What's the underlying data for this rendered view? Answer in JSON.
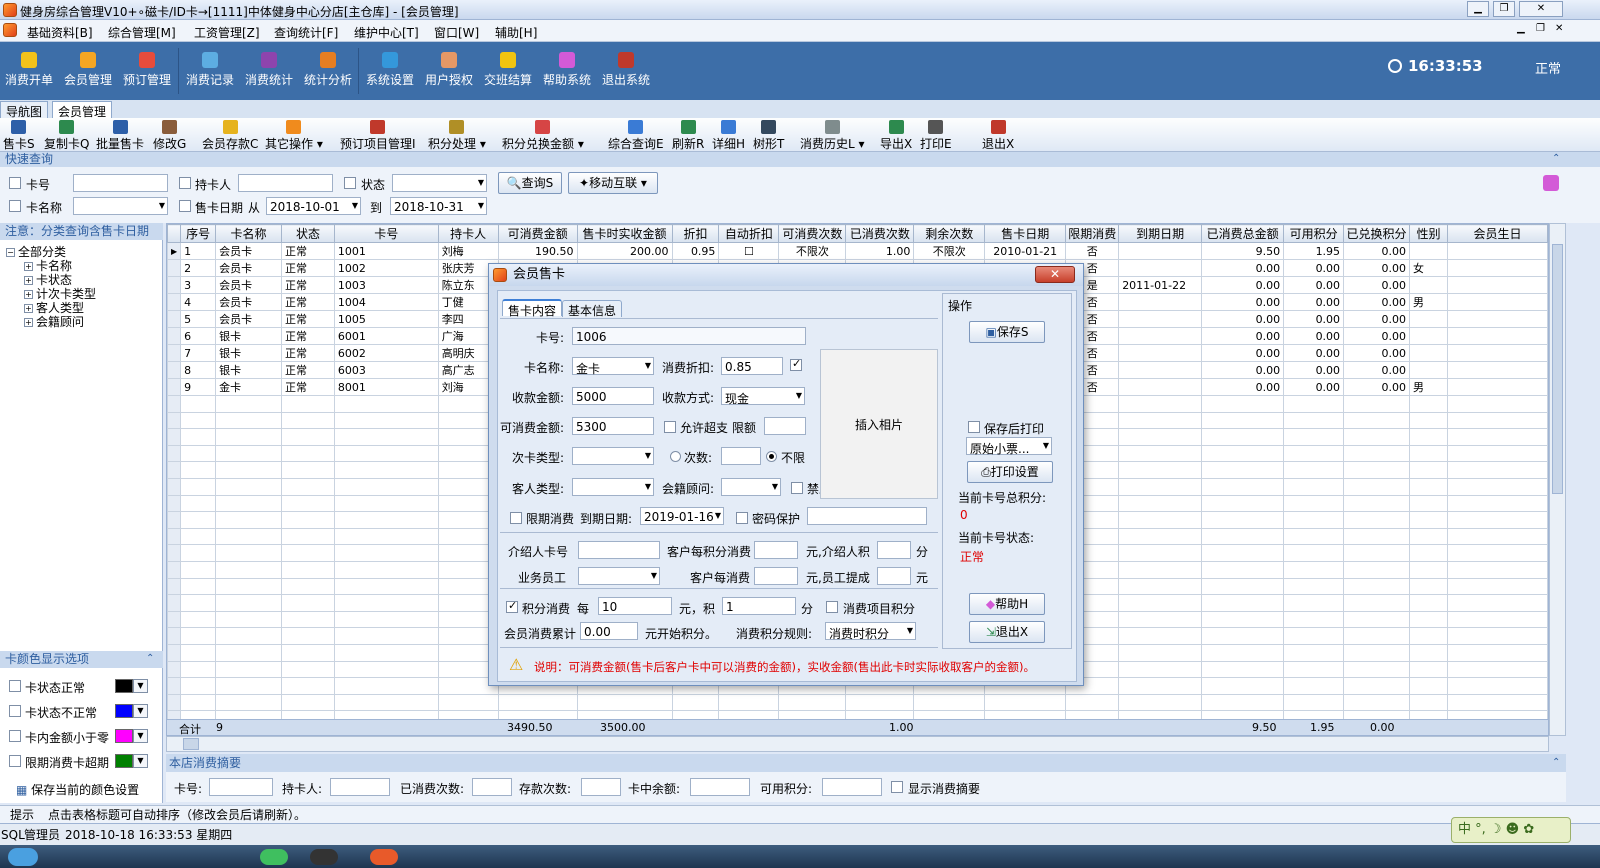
{
  "window": {
    "title": "健身房综合管理V10+∘磁卡/ID卡→[1111]中体健身中心分店[主仓库] - [会员管理]"
  },
  "menu": [
    "基础资料[B]",
    "综合管理[M]",
    "工资管理[Z]",
    "查询统计[F]",
    "维护中心[T]",
    "窗口[W]",
    "辅助[H]"
  ],
  "main_toolbar": [
    {
      "label": "消费开单",
      "icon": "coin-icon",
      "color": "#f2c21b"
    },
    {
      "label": "会员管理",
      "icon": "members-icon",
      "color": "#f5a623"
    },
    {
      "label": "预订管理",
      "icon": "booking-icon",
      "color": "#e74c3c"
    },
    {
      "label": "消费记录",
      "icon": "record-icon",
      "color": "#5dade2"
    },
    {
      "label": "消费统计",
      "icon": "stats-icon",
      "color": "#8e44ad"
    },
    {
      "label": "统计分析",
      "icon": "analysis-icon",
      "color": "#e67e22"
    },
    {
      "label": "系统设置",
      "icon": "settings-icon",
      "color": "#3498db"
    },
    {
      "label": "用户授权",
      "icon": "user-icon",
      "color": "#e59866"
    },
    {
      "label": "交班结算",
      "icon": "handover-icon",
      "color": "#f1c40f"
    },
    {
      "label": "帮助系统",
      "icon": "help-icon",
      "color": "#d35ad7"
    },
    {
      "label": "退出系统",
      "icon": "exit-icon",
      "color": "#c0392b"
    }
  ],
  "clock": "16:33:53",
  "status_mode": "正常",
  "tabs": [
    "导航图",
    "会员管理"
  ],
  "toolbar": [
    {
      "label": "售卡S",
      "icon": "card-icon"
    },
    {
      "label": "复制卡Q",
      "icon": "copy-card-icon"
    },
    {
      "label": "批量售卡",
      "icon": "batch-card-icon"
    },
    {
      "label": "修改G",
      "icon": "edit-icon"
    },
    {
      "label": "会员存款C",
      "icon": "deposit-icon"
    },
    {
      "label": "其它操作",
      "icon": "other-icon"
    },
    {
      "label": "预订项目管理I",
      "icon": "project-icon"
    },
    {
      "label": "积分处理",
      "icon": "points-icon"
    },
    {
      "label": "积分兑换金额",
      "icon": "exchange-icon"
    },
    {
      "label": "综合查询E",
      "icon": "query-icon"
    },
    {
      "label": "刷新R",
      "icon": "refresh-icon"
    },
    {
      "label": "详细H",
      "icon": "detail-icon"
    },
    {
      "label": "树形T",
      "icon": "tree-icon"
    },
    {
      "label": "消费历史L",
      "icon": "history-icon"
    },
    {
      "label": "导出X",
      "icon": "export-icon"
    },
    {
      "label": "打印E",
      "icon": "print-icon"
    },
    {
      "label": "退出X",
      "icon": "exit-icon"
    }
  ],
  "quick": {
    "header": "快速查询",
    "card_no": "卡号",
    "holder": "持卡人",
    "state": "状态",
    "card_name": "卡名称",
    "sale_date": "售卡日期",
    "from": "从",
    "to": "到",
    "date_from": "2018-10-01",
    "date_to": "2018-10-31",
    "query_btn": "查询S",
    "mobile_btn": "移动互联"
  },
  "left": {
    "notice": "注意：分类查询含售卡日期",
    "tree_root": "全部分类",
    "tree_items": [
      "卡名称",
      "卡状态",
      "计次卡类型",
      "客人类型",
      "会籍顾问"
    ],
    "color_header": "卡颜色显示选项",
    "color_opts": [
      {
        "label": "卡状态正常",
        "color": "#000000"
      },
      {
        "label": "卡状态不正常",
        "color": "#0000ff"
      },
      {
        "label": "卡内金额小于零",
        "color": "#ff00ff"
      },
      {
        "label": "限期消费卡超期",
        "color": "#008000"
      }
    ],
    "save_colors": "保存当前的颜色设置"
  },
  "table": {
    "columns": [
      "序号",
      "卡名称",
      "状态",
      "卡号",
      "持卡人",
      "可消费金额",
      "售卡时实收金额",
      "折扣",
      "自动折扣",
      "可消费次数",
      "已消费次数",
      "剩余次数",
      "售卡日期",
      "限期消费",
      "到期日期",
      "已消费总金额",
      "可用积分",
      "已兑换积分",
      "性别",
      "会员生日"
    ],
    "rows": [
      [
        "1",
        "会员卡",
        "正常",
        "1001",
        "刘梅",
        "190.50",
        "200.00",
        "0.95",
        "☐",
        "不限次",
        "1.00",
        "不限次",
        "2010-01-21",
        "否",
        "",
        "9.50",
        "1.95",
        "0.00",
        "",
        ""
      ],
      [
        "2",
        "会员卡",
        "正常",
        "1002",
        "张庆芳",
        "",
        "",
        "",
        "",
        "",
        "",
        "",
        "",
        "否",
        "",
        "0.00",
        "0.00",
        "0.00",
        "女",
        ""
      ],
      [
        "3",
        "会员卡",
        "正常",
        "1003",
        "陈立东",
        "",
        "",
        "",
        "",
        "",
        "",
        "",
        "",
        "是",
        "2011-01-22",
        "0.00",
        "0.00",
        "0.00",
        "",
        ""
      ],
      [
        "4",
        "会员卡",
        "正常",
        "1004",
        "丁健",
        "",
        "",
        "",
        "",
        "",
        "",
        "",
        "",
        "否",
        "",
        "0.00",
        "0.00",
        "0.00",
        "男",
        ""
      ],
      [
        "5",
        "会员卡",
        "正常",
        "1005",
        "李四",
        "",
        "",
        "",
        "",
        "",
        "",
        "",
        "",
        "否",
        "",
        "0.00",
        "0.00",
        "0.00",
        "",
        ""
      ],
      [
        "6",
        "银卡",
        "正常",
        "6001",
        "广海",
        "",
        "",
        "",
        "",
        "",
        "",
        "",
        "",
        "否",
        "",
        "0.00",
        "0.00",
        "0.00",
        "",
        ""
      ],
      [
        "7",
        "银卡",
        "正常",
        "6002",
        "高明庆",
        "",
        "",
        "",
        "",
        "",
        "",
        "",
        "",
        "否",
        "",
        "0.00",
        "0.00",
        "0.00",
        "",
        ""
      ],
      [
        "8",
        "银卡",
        "正常",
        "6003",
        "高广志",
        "",
        "",
        "",
        "",
        "",
        "",
        "",
        "",
        "否",
        "",
        "0.00",
        "0.00",
        "0.00",
        "",
        ""
      ],
      [
        "9",
        "金卡",
        "正常",
        "8001",
        "刘海",
        "",
        "",
        "",
        "",
        "",
        "",
        "",
        "",
        "否",
        "",
        "0.00",
        "0.00",
        "0.00",
        "男",
        ""
      ]
    ],
    "total": {
      "label": "合计",
      "count": "9",
      "consumable": "3490.50",
      "received": "3500.00",
      "used_times": "1.00",
      "spent": "9.50",
      "points": "1.95",
      "exchanged": "0.00"
    }
  },
  "summary": {
    "header": "本店消费摘要",
    "fields": [
      "卡号:",
      "持卡人:",
      "已消费次数:",
      "存款次数:",
      "卡中余额:",
      "可用积分:"
    ],
    "show_summary": "显示消费摘要"
  },
  "hint": {
    "label": "提示",
    "text": "点击表格标题可自动排序（修改会员后请刷新）。"
  },
  "statusbar": {
    "db": "SQL",
    "user": "管理员",
    "datetime": "2018-10-18 16:33:53 星期四"
  },
  "ime": "中 °, ☽ ☻ ✿",
  "dialog": {
    "title": "会员售卡",
    "tab_sale": "售卡内容",
    "tab_basic": "基本信息",
    "card_no_label": "卡号:",
    "card_no": "1006",
    "card_name_label": "卡名称:",
    "card_name": "金卡",
    "discount_label": "消费折扣:",
    "discount": "0.85",
    "pay_amount_label": "收款金额:",
    "pay_amount": "5000",
    "pay_method_label": "收款方式:",
    "pay_method": "现金",
    "consumable_label": "可消费金额:",
    "consumable": "5300",
    "overdraft_label": "允许超支",
    "limit_label": "限额",
    "times_type_label": "次卡类型:",
    "times_label": "次数:",
    "unlimited_label": "不限",
    "guest_type_label": "客人类型:",
    "advisor_label": "会籍顾问:",
    "forbid_label": "禁止实时计时",
    "limit_consume_label": "限期消费",
    "expire_label": "到期日期:",
    "expire_date": "2019-01-16",
    "password_label": "密码保护",
    "photo": "插入相片",
    "referrer_label": "介绍人卡号",
    "per_point_label": "客户每积分消费",
    "yuan_ref_label": "元,介绍人积",
    "fen1": "分",
    "staff_label": "业务员工",
    "per_consume_label": "客户每消费",
    "yuan_staff_label": "元,员工提成",
    "yuan2": "元",
    "point_consume_label": "积分消费",
    "every_label": "每",
    "every_value": "10",
    "yuan_pt_label": "元，积",
    "pt_value": "1",
    "fen2": "分",
    "item_points_label": "消费项目积分",
    "cumulative_label": "会员消费累计",
    "cumulative": "0.00",
    "start_points_label": "元开始积分。",
    "rule_label": "消费积分规则:",
    "rule": "消费时积分",
    "ops_label": "操作",
    "save_btn": "保存S",
    "print_after_label": "保存后打印",
    "print_template": "原始小票...",
    "print_setup_btn": "打印设置",
    "total_points_label": "当前卡号总积分:",
    "total_points": "0",
    "card_state_label": "当前卡号状态:",
    "card_state": "正常",
    "help_btn": "帮助H",
    "exit_btn": "退出X",
    "note": "说明：可消费金额(售卡后客户卡中可以消费的金额)，实收金额(售出此卡时实际收取客户的金额)。"
  }
}
